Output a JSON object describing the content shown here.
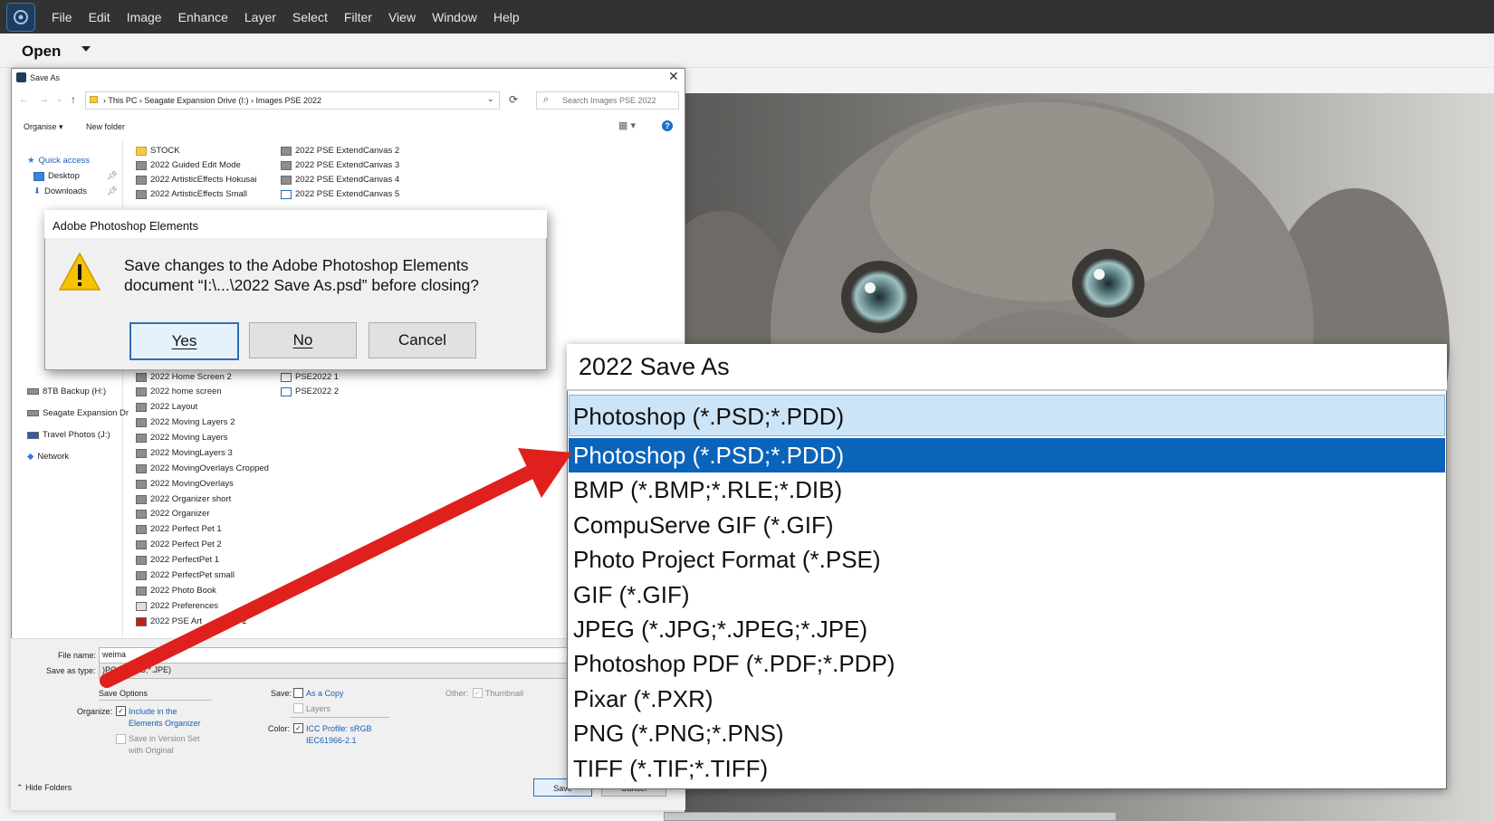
{
  "app": {
    "menu": [
      "File",
      "Edit",
      "Image",
      "Enhance",
      "Layer",
      "Select",
      "Filter",
      "View",
      "Window",
      "Help"
    ],
    "open_label": "Open"
  },
  "save_as_dialog": {
    "title": "Save As",
    "breadcrumb": [
      "This PC",
      "Seagate Expansion Drive (I:)",
      "Images PSE 2022"
    ],
    "search_placeholder": "Search Images PSE 2022",
    "toolbar": {
      "organise": "Organise",
      "new_folder": "New folder"
    },
    "nav": {
      "quick_access": "Quick access",
      "desktop": "Desktop",
      "downloads": "Downloads",
      "backup": "8TB Backup (H:)",
      "seagate": "Seagate Expansion Dr",
      "travel": "Travel Photos (J:)",
      "network": "Network"
    },
    "files_col1_top": [
      "STOCK",
      "2022  Guided Edit Mode",
      "2022 ArtisticEffects Hokusai",
      "2022 ArtisticEffects Small"
    ],
    "files_col2_top": [
      "2022 PSE ExtendCanvas 2",
      "2022 PSE ExtendCanvas 3",
      "2022 PSE ExtendCanvas 4",
      "2022 PSE ExtendCanvas 5"
    ],
    "files_col1": [
      "2022 Home Screen 2",
      "2022 home screen",
      "2022 Layout",
      "2022 Moving Layers 2",
      "2022 Moving Layers",
      "2022 MovingLayers 3",
      "2022 MovingOverlays Cropped",
      "2022 MovingOverlays",
      "2022 Organizer short",
      "2022 Organizer",
      "2022 Perfect Pet 1",
      "2022 Perfect Pet 2",
      "2022 PerfectPet 1",
      "2022 PerfectPet small",
      "2022 Photo Book",
      "2022 Preferences",
      "2022 PSE Art"
    ],
    "files_col1_tail": "s 2",
    "files_col2": [
      "PSE2022 1",
      "PSE2022 2"
    ],
    "file_name_label": "File name:",
    "file_name_value": "weima",
    "save_type_label": "Save as type:",
    "save_type_value": ")PG;*.JPEG;*.JPE)",
    "save_options": {
      "heading": "Save Options",
      "organize_label": "Organize:",
      "include_organizer_1": "Include in the",
      "include_organizer_2": "Elements Organizer",
      "version_set_1": "Save in Version Set",
      "version_set_2": "with Original",
      "save_label": "Save:",
      "as_copy": "As a Copy",
      "layers": "Layers",
      "color_label": "Color:",
      "icc_1": "ICC Profile:  sRGB",
      "icc_2": "IEC61966-2.1",
      "other_label": "Other:",
      "thumbnail": "Thumbnail"
    },
    "hide_folders": "Hide Folders",
    "save_button": "Save",
    "cancel_button": "Cancel"
  },
  "message_box": {
    "title": "Adobe Photoshop Elements",
    "line1": "Save changes to the Adobe Photoshop Elements",
    "line2": "document “I:\\...\\2022 Save As.psd” before closing?",
    "yes": "Yes",
    "no": "No",
    "cancel": "Cancel"
  },
  "zoom_dropdown": {
    "file_name": "2022 Save As",
    "selected": "Photoshop (*.PSD;*.PDD)",
    "options": [
      "Photoshop (*.PSD;*.PDD)",
      "BMP (*.BMP;*.RLE;*.DIB)",
      "CompuServe GIF (*.GIF)",
      "Photo Project Format (*.PSE)",
      "GIF (*.GIF)",
      "JPEG (*.JPG;*.JPEG;*.JPE)",
      "Photoshop PDF (*.PDF;*.PDP)",
      "Pixar (*.PXR)",
      "PNG (*.PNG;*.PNS)",
      "TIFF (*.TIF;*.TIFF)"
    ],
    "highlighted_index": 0
  },
  "colors": {
    "menubar": "#323232",
    "highlight": "#0a64b9",
    "selected_bg": "#cce4f7",
    "arrow": "#e0201c",
    "warning": "#f5c400"
  },
  "icons": [
    "app-logo-icon",
    "close-icon",
    "back-arrow-icon",
    "forward-arrow-icon",
    "up-arrow-icon",
    "refresh-icon",
    "search-icon",
    "help-icon",
    "view-icon",
    "warning-icon",
    "folder-icon",
    "image-file-icon",
    "pin-icon",
    "chevron-down-icon"
  ]
}
